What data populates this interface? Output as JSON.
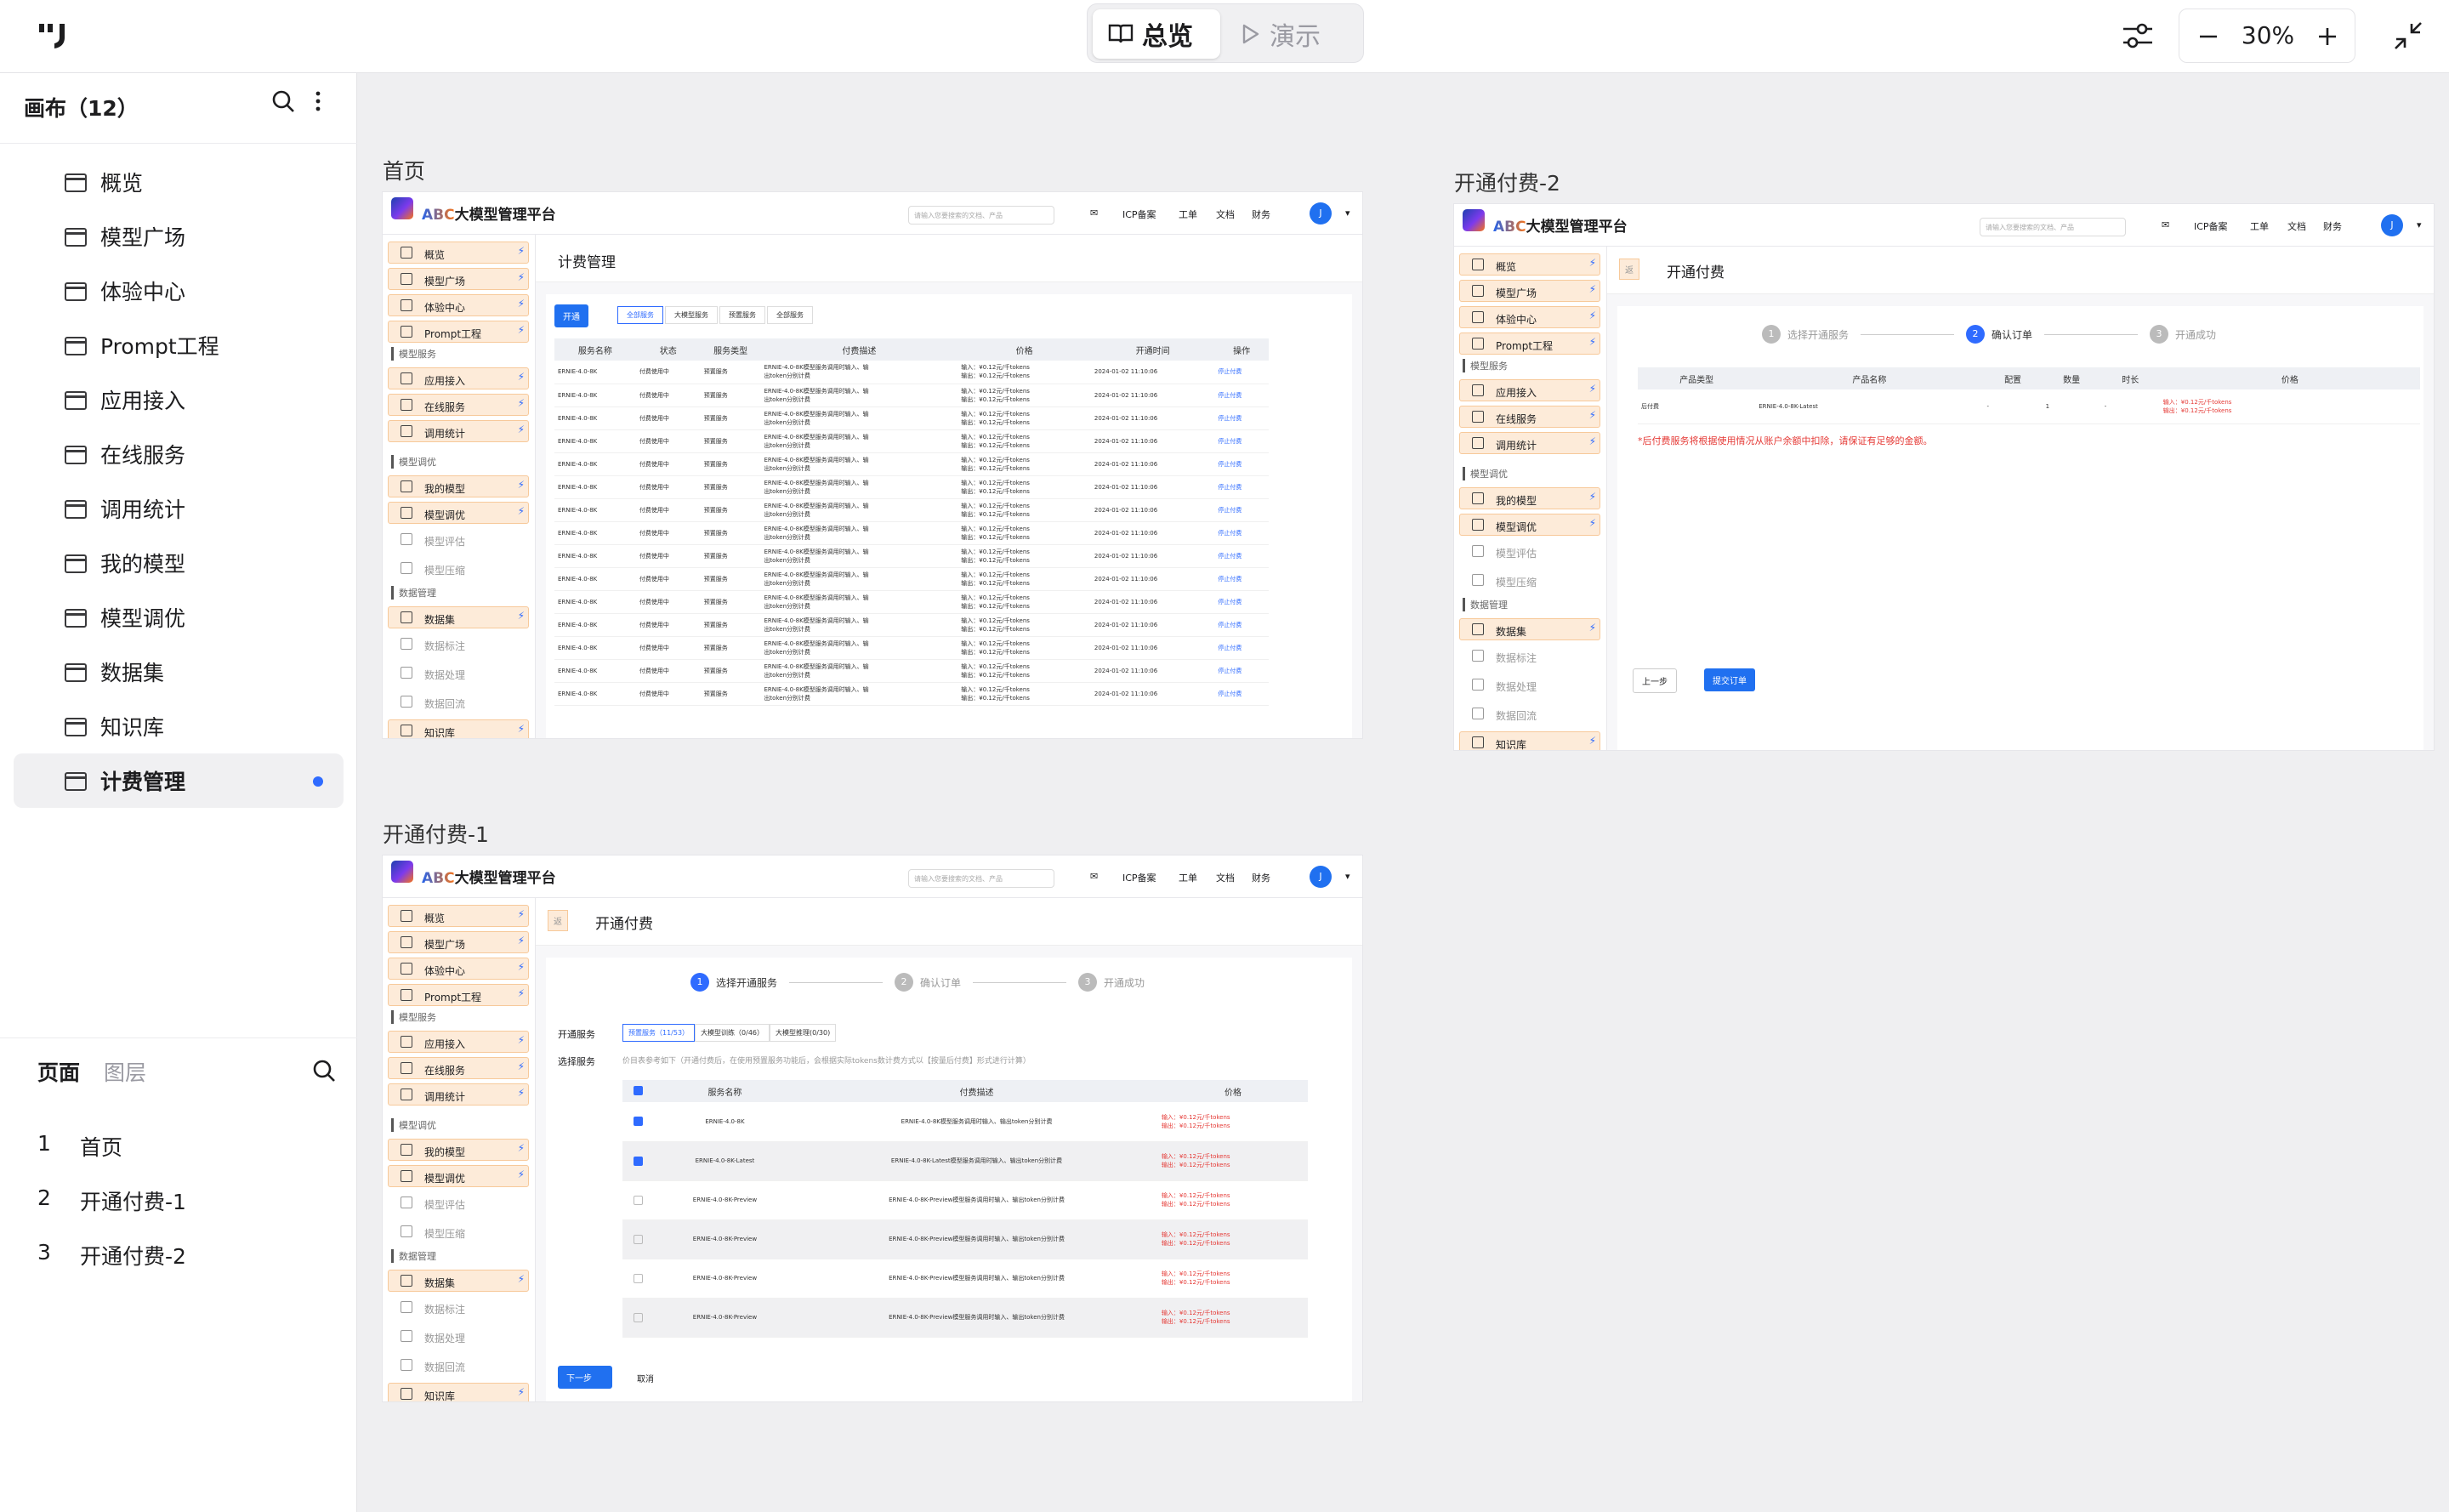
{
  "topbar": {
    "mode_overview": "总览",
    "mode_present": "演示",
    "zoom": "30%"
  },
  "sidebar": {
    "header": "画布（12）",
    "canvases": [
      "概览",
      "模型广场",
      "体验中心",
      "Prompt工程",
      "应用接入",
      "在线服务",
      "调用统计",
      "我的模型",
      "模型调优",
      "数据集",
      "知识库",
      "计费管理"
    ],
    "selected_index": 11,
    "tab_pages": "页面",
    "tab_layers": "图层",
    "pages": [
      {
        "num": "1",
        "name": "首页"
      },
      {
        "num": "2",
        "name": "开通付费-1"
      },
      {
        "num": "3",
        "name": "开通付费-2"
      }
    ]
  },
  "frames": {
    "home_title": "首页",
    "pay1_title": "开通付费-1",
    "pay2_title": "开通付费-2"
  },
  "app": {
    "brand_abc": "ABC",
    "brand_rest": "大模型管理平台",
    "search_placeholder": "请输入您要搜索的文档、产品",
    "nav": [
      "ICP备案",
      "工单",
      "文档",
      "财务"
    ],
    "avatar": "J",
    "menu": {
      "top": [
        "概览",
        "模型广场",
        "体验中心",
        "Prompt工程"
      ],
      "sec1": "模型服务",
      "sec1_items": [
        "应用接入",
        "在线服务",
        "调用统计"
      ],
      "sec2": "模型调优",
      "sec2_items": [
        "我的模型",
        "模型调优"
      ],
      "sec2_plain": [
        "模型评估",
        "模型压缩"
      ],
      "sec3": "数据管理",
      "sec3_items": [
        "数据集"
      ],
      "sec3_plain": [
        "数据标注",
        "数据处理",
        "数据回流"
      ],
      "last": "知识库"
    }
  },
  "billing": {
    "title": "计费管理",
    "open_btn": "开通",
    "filters": [
      "全部服务",
      "大模型服务",
      "预置服务",
      "全部服务"
    ],
    "columns": [
      "服务名称",
      "状态",
      "服务类型",
      "付费描述",
      "价格",
      "开通时间",
      "操作"
    ],
    "row": {
      "name": "ERNIE-4.0-8K",
      "status": "付费使用中",
      "type": "预置服务",
      "desc1": "ERNIE-4.0-8K模型服务调用时输入、输",
      "desc2": "出token分别计费",
      "price1": "输入：¥0.12元/千tokens",
      "price2": "输出：¥0.12元/千tokens",
      "time": "2024-01-02 11:10:06",
      "action": "停止付费"
    },
    "row_count": 15
  },
  "pay1": {
    "back": "返",
    "title": "开通付费",
    "steps": [
      "选择开通服务",
      "确认订单",
      "开通成功"
    ],
    "label_service": "开通服务",
    "service_tabs": [
      "预置服务（11/53）",
      "大模型训练（0/46）",
      "大模型推理(0/30)"
    ],
    "label_select": "选择服务",
    "select_hint": "价目表参考如下（开通付费后，在使用预置服务功能后，会根据实际tokens数计费方式以【按量后付费】形式进行计算）",
    "columns": [
      "服务名称",
      "付费描述",
      "价格"
    ],
    "rows": [
      {
        "checked": true,
        "name": "ERNIE-4.0-8K",
        "desc": "ERNIE-4.0-8K模型服务调用时输入、输出token分别计费"
      },
      {
        "checked": true,
        "name": "ERNIE-4.0-8K-Latest",
        "desc": "ERNIE-4.0-8K-Latest模型服务调用时输入、输出token分别计费"
      },
      {
        "checked": false,
        "name": "ERNIE-4.0-8K-Preview",
        "desc": "ERNIE-4.0-8K-Preview模型服务调用时输入、输出token分别计费"
      },
      {
        "checked": false,
        "name": "ERNIE-4.0-8K-Preview",
        "desc": "ERNIE-4.0-8K-Preview模型服务调用时输入、输出token分别计费"
      },
      {
        "checked": false,
        "name": "ERNIE-4.0-8K-Preview",
        "desc": "ERNIE-4.0-8K-Preview模型服务调用时输入、输出token分别计费"
      },
      {
        "checked": false,
        "name": "ERNIE-4.0-8K-Preview",
        "desc": "ERNIE-4.0-8K-Preview模型服务调用时输入、输出token分别计费"
      }
    ],
    "price1": "输入：¥0.12元/千tokens",
    "price2": "输出：¥0.12元/千tokens",
    "next_btn": "下一步",
    "cancel_btn": "取消"
  },
  "pay2": {
    "back": "返",
    "title": "开通付费",
    "steps": [
      "选择开通服务",
      "确认订单",
      "开通成功"
    ],
    "columns": [
      "产品类型",
      "产品名称",
      "配置",
      "数量",
      "时长",
      "价格"
    ],
    "row": {
      "type": "后付费",
      "name": "ERNIE-4.0-8K-Latest",
      "config": "-",
      "qty": "1",
      "duration": "-",
      "price1": "输入：¥0.12元/千tokens",
      "price2": "输出：¥0.12元/千tokens"
    },
    "note": "*后付费服务将根据使用情况从账户余额中扣除，请保证有足够的金额。",
    "prev_btn": "上一步",
    "submit_btn": "提交订单"
  }
}
